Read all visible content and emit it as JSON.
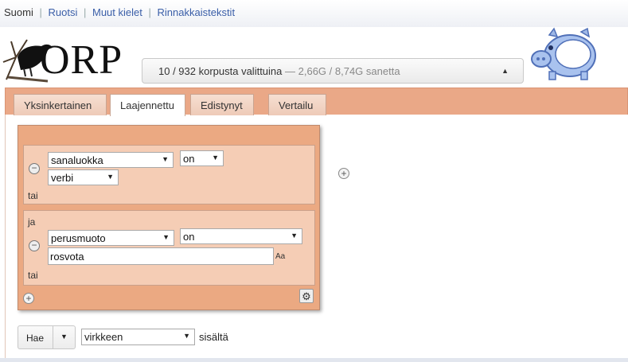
{
  "langbar": {
    "current": "Suomi",
    "links": [
      "Ruotsi",
      "Muut kielet",
      "Rinnakkaistekstit"
    ]
  },
  "logo": {
    "text": "ORP"
  },
  "corpus": {
    "selected": "10 / 932 korpusta valittuina",
    "tokens": "— 2,66G / 8,74G sanetta"
  },
  "tabs": [
    {
      "label": "Yksinkertainen",
      "active": false
    },
    {
      "label": "Laajennettu",
      "active": true
    },
    {
      "label": "Edistynyt",
      "active": false
    },
    {
      "label": "Vertailu",
      "active": false
    }
  ],
  "query": {
    "group1": {
      "attribute": "sanaluokka",
      "operator": "on",
      "value": "verbi",
      "or_label": "tai"
    },
    "group2": {
      "and_label": "ja",
      "attribute": "perusmuoto",
      "operator": "on",
      "value": "rosvota",
      "case_label": "Aa",
      "or_label": "tai"
    }
  },
  "search": {
    "button_label": "Hae",
    "within_value": "virkkeen",
    "within_suffix": "sisältä"
  },
  "colors": {
    "accent": "#eba982",
    "group_bg": "#f5cdb5",
    "link": "#3a5ea8"
  }
}
